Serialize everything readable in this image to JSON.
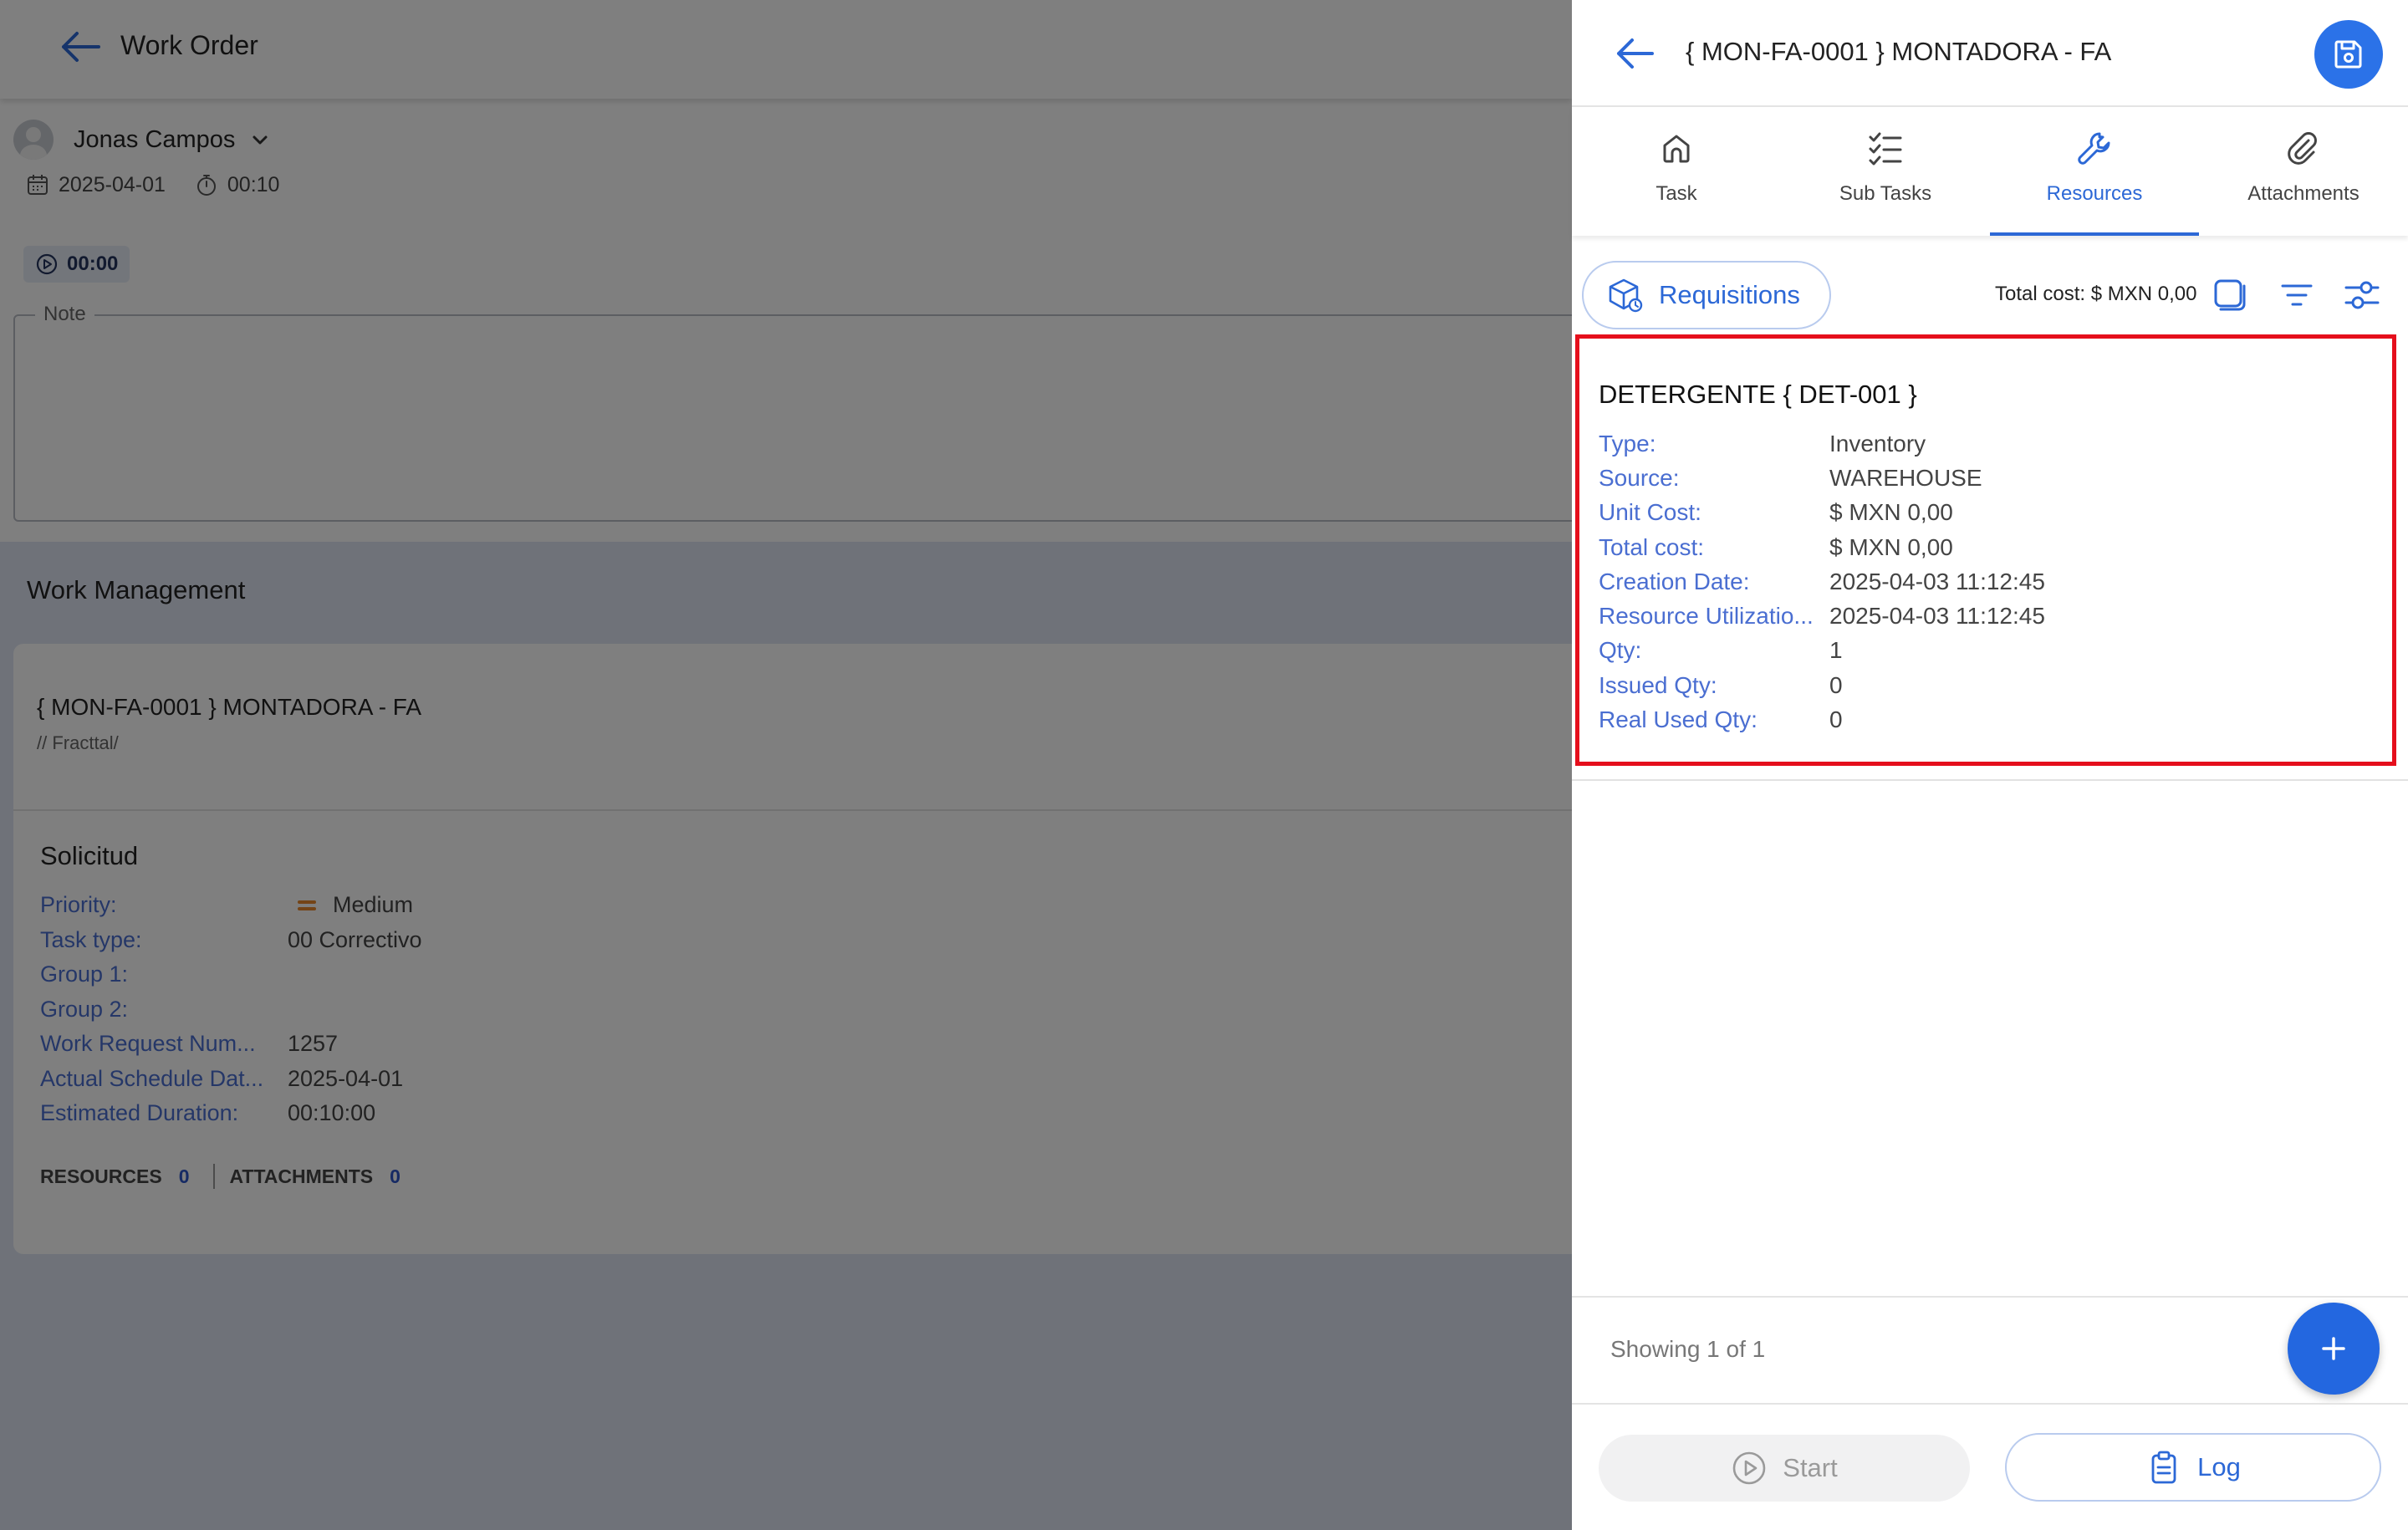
{
  "background": {
    "header": {
      "title": "Work Order"
    },
    "user": {
      "name": "Jonas Campos"
    },
    "meta": {
      "date": "2025-04-01",
      "duration": "00:10"
    },
    "timer": {
      "value": "00:00"
    },
    "note": {
      "label": "Note"
    },
    "work_management": {
      "title": "Work Management",
      "card": {
        "heading": "{ MON-FA-0001 } MONTADORA - FA",
        "subheading": "// Fracttal/",
        "section_title": "Solicitud",
        "fields": [
          {
            "key": "Priority:",
            "value": "Medium"
          },
          {
            "key": "Task type:",
            "value": "00 Correctivo"
          },
          {
            "key": "Group 1:",
            "value": ""
          },
          {
            "key": "Group 2:",
            "value": ""
          },
          {
            "key": "Work Request Num...",
            "value": "1257"
          },
          {
            "key": "Actual Schedule Dat...",
            "value": "2025-04-01"
          },
          {
            "key": "Estimated Duration:",
            "value": "00:10:00"
          }
        ],
        "counters": {
          "resources_label": "RESOURCES",
          "resources_count": "0",
          "attachments_label": "ATTACHMENTS",
          "attachments_count": "0"
        }
      }
    }
  },
  "panel": {
    "title": "{ MON-FA-0001 } MONTADORA - FA",
    "tabs": [
      {
        "label": "Task",
        "icon": "home-icon"
      },
      {
        "label": "Sub Tasks",
        "icon": "checklist-icon"
      },
      {
        "label": "Resources",
        "icon": "wrench-icon",
        "active": true
      },
      {
        "label": "Attachments",
        "icon": "paperclip-icon"
      }
    ],
    "toolbar": {
      "requisitions_label": "Requisitions",
      "total_cost": "Total cost: $ MXN 0,00"
    },
    "resource": {
      "title": "DETERGENTE { DET-001 }",
      "fields": [
        {
          "key": "Type:",
          "value": "Inventory"
        },
        {
          "key": "Source:",
          "value": "WAREHOUSE"
        },
        {
          "key": "Unit Cost:",
          "value": "$ MXN 0,00"
        },
        {
          "key": "Total cost:",
          "value": "$ MXN 0,00"
        },
        {
          "key": "Creation Date:",
          "value": "2025-04-03 11:12:45"
        },
        {
          "key": "Resource Utilizatio...",
          "value": "2025-04-03 11:12:45"
        },
        {
          "key": "Qty:",
          "value": "1"
        },
        {
          "key": "Issued Qty:",
          "value": "0"
        },
        {
          "key": "Real Used Qty:",
          "value": "0"
        }
      ]
    },
    "footer": {
      "showing": "Showing 1 of 1",
      "start_label": "Start",
      "log_label": "Log"
    }
  },
  "colors": {
    "accent": "#2c68d6",
    "highlight": "#e50f1c",
    "fab": "#2367e0",
    "label_blue": "#4a6ed1"
  }
}
